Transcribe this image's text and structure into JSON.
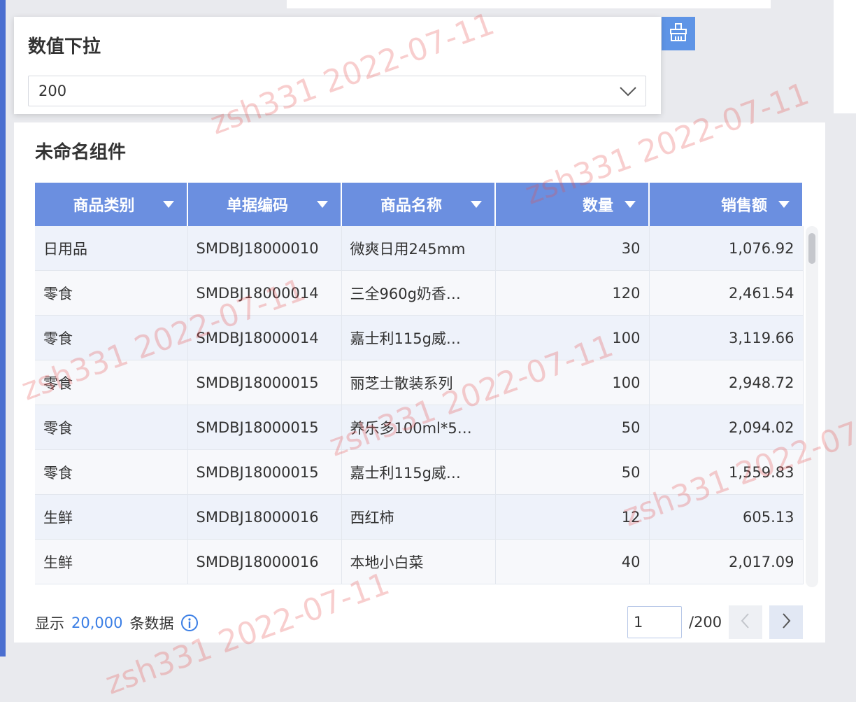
{
  "filter": {
    "title": "数值下拉",
    "selected_value": "200",
    "chevron_icon": "chevron-down-icon"
  },
  "toolbar": {
    "broom_icon": "broom-icon",
    "accent": "#5e94e6"
  },
  "table": {
    "title": "未命名组件",
    "header_color": "#6b8fe0",
    "columns": [
      "商品类别",
      "单据编码",
      "商品名称",
      "数量",
      "销售额"
    ],
    "rows": [
      [
        "日用品",
        "SMDBJ18000010",
        "微爽日用245mm",
        "30",
        "1,076.92"
      ],
      [
        "零食",
        "SMDBJ18000014",
        "三全960g奶香…",
        "120",
        "2,461.54"
      ],
      [
        "零食",
        "SMDBJ18000014",
        "嘉士利115g威…",
        "100",
        "3,119.66"
      ],
      [
        "零食",
        "SMDBJ18000015",
        "丽芝士散装系列",
        "100",
        "2,948.72"
      ],
      [
        "零食",
        "SMDBJ18000015",
        "养乐多100ml*5…",
        "50",
        "2,094.02"
      ],
      [
        "零食",
        "SMDBJ18000015",
        "嘉士利115g威…",
        "50",
        "1,559.83"
      ],
      [
        "生鲜",
        "SMDBJ18000016",
        "西红柿",
        "12",
        "605.13"
      ],
      [
        "生鲜",
        "SMDBJ18000016",
        "本地小白菜",
        "40",
        "2,017.09"
      ]
    ]
  },
  "footer": {
    "prefix": "显示",
    "count": "20,000",
    "suffix": "条数据",
    "info_icon": "info-icon"
  },
  "pager": {
    "current_page": "1",
    "total": "/200",
    "prev_icon": "chevron-left-icon",
    "next_icon": "chevron-right-icon"
  },
  "watermark": {
    "text": "zsh331 2022-07-11"
  }
}
